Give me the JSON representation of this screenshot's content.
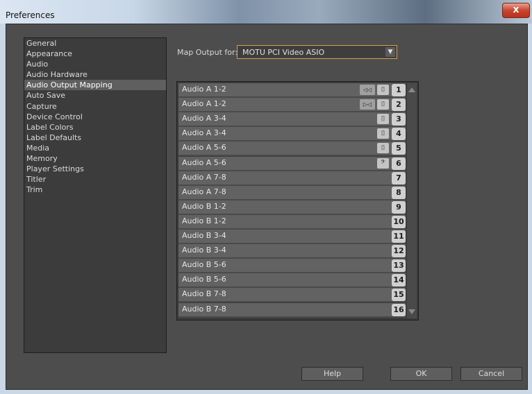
{
  "window": {
    "title": "Preferences",
    "close_label": "x"
  },
  "categories": [
    {
      "label": "General"
    },
    {
      "label": "Appearance"
    },
    {
      "label": "Audio"
    },
    {
      "label": "Audio Hardware"
    },
    {
      "label": "Audio Output Mapping",
      "selected": true
    },
    {
      "label": "Auto Save"
    },
    {
      "label": "Capture"
    },
    {
      "label": "Device Control"
    },
    {
      "label": "Label Colors"
    },
    {
      "label": "Label Defaults"
    },
    {
      "label": "Media"
    },
    {
      "label": "Memory"
    },
    {
      "label": "Player Settings"
    },
    {
      "label": "Titler"
    },
    {
      "label": "Trim"
    }
  ],
  "map_output": {
    "label": "Map Output for:",
    "value": "MOTU PCI Video ASIO"
  },
  "channels": [
    {
      "label": "Audio A 1-2",
      "num": "1",
      "icons": [
        "stereo-left-icon",
        "mono-clip-icon"
      ]
    },
    {
      "label": "Audio A 1-2",
      "num": "2",
      "icons": [
        "stereo-right-icon",
        "mono-clip-icon"
      ]
    },
    {
      "label": "Audio A 3-4",
      "num": "3",
      "icons": [
        "mono-clip-icon"
      ]
    },
    {
      "label": "Audio A 3-4",
      "num": "4",
      "icons": [
        "mono-clip-icon"
      ]
    },
    {
      "label": "Audio A 5-6",
      "num": "5",
      "icons": [
        "mono-clip-icon"
      ]
    },
    {
      "label": "Audio A 5-6",
      "num": "6",
      "icons": [
        "bass-clef-icon"
      ]
    },
    {
      "label": "Audio A 7-8",
      "num": "7",
      "icons": []
    },
    {
      "label": "Audio A 7-8",
      "num": "8",
      "icons": []
    },
    {
      "label": "Audio B 1-2",
      "num": "9",
      "icons": []
    },
    {
      "label": "Audio B 1-2",
      "num": "10",
      "icons": []
    },
    {
      "label": "Audio B 3-4",
      "num": "11",
      "icons": []
    },
    {
      "label": "Audio B 3-4",
      "num": "12",
      "icons": []
    },
    {
      "label": "Audio B 5-6",
      "num": "13",
      "icons": []
    },
    {
      "label": "Audio B 5-6",
      "num": "14",
      "icons": []
    },
    {
      "label": "Audio B 7-8",
      "num": "15",
      "icons": []
    },
    {
      "label": "Audio B 7-8",
      "num": "16",
      "icons": []
    }
  ],
  "buttons": {
    "help": "Help",
    "ok": "OK",
    "cancel": "Cancel"
  }
}
